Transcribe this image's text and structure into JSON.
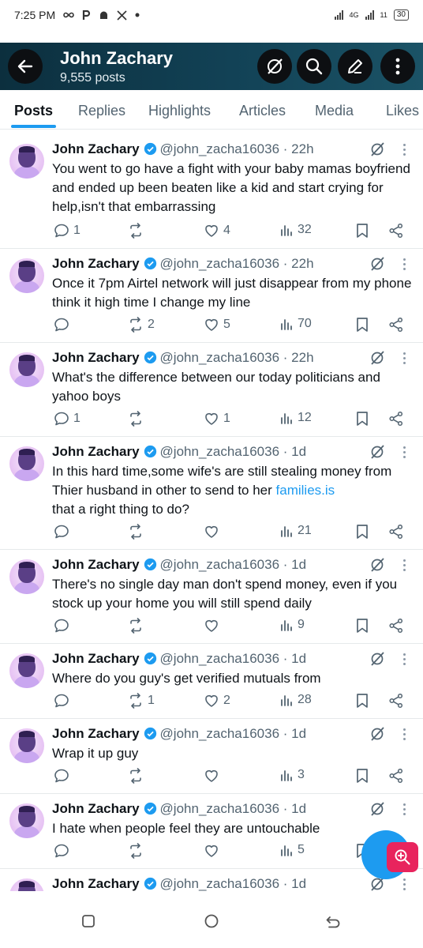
{
  "status_bar": {
    "time": "7:25 PM",
    "app_icons": [
      "infinity-icon",
      "p-icon",
      "android-icon",
      "x-icon",
      "dot-icon"
    ],
    "network": "4G",
    "signal2": "11",
    "battery": "30"
  },
  "header": {
    "name": "John Zachary",
    "post_count": "9,555 posts"
  },
  "tabs": [
    {
      "label": "Posts",
      "active": true
    },
    {
      "label": "Replies"
    },
    {
      "label": "Highlights"
    },
    {
      "label": "Articles"
    },
    {
      "label": "Media"
    },
    {
      "label": "Likes"
    }
  ],
  "tweets": [
    {
      "name": "John Zachary",
      "handle": "@john_zacha16036",
      "time": "· 22h",
      "text": "You went to go have a fight with your baby mamas boyfriend and ended up been beaten like a kid and start crying for help,isn't that embarrassing",
      "replies": "1",
      "reposts": "",
      "likes": "4",
      "views": "32"
    },
    {
      "name": "John Zachary",
      "handle": "@john_zacha16036",
      "time": "· 22h",
      "text": "Once it 7pm Airtel network will just disappear from my phone think it high time I change my line",
      "replies": "",
      "reposts": "2",
      "likes": "5",
      "views": "70"
    },
    {
      "name": "John Zachary",
      "handle": "@john_zacha16036",
      "time": "· 22h",
      "text": "What's the difference between our today politicians and yahoo boys",
      "replies": "1",
      "reposts": "",
      "likes": "1",
      "views": "12"
    },
    {
      "name": "John Zachary",
      "handle": "@john_zacha16036",
      "time": "· 1d",
      "text": "In this hard time,some wife's are still stealing money from Thier husband in other to send to her",
      "link": "families.is",
      "text_after": "that a right thing to do?",
      "replies": "",
      "reposts": "",
      "likes": "",
      "views": "21"
    },
    {
      "name": "John Zachary",
      "handle": "@john_zacha16036",
      "time": "· 1d",
      "text": "There's no single day man don't spend money, even if you stock up your home you will still spend daily",
      "replies": "",
      "reposts": "",
      "likes": "",
      "views": "9"
    },
    {
      "name": "John Zachary",
      "handle": "@john_zacha16036",
      "time": "· 1d",
      "text": "Where do you guy's get verified mutuals from",
      "replies": "",
      "reposts": "1",
      "likes": "2",
      "views": "28"
    },
    {
      "name": "John Zachary",
      "handle": "@john_zacha16036",
      "time": "· 1d",
      "text": "Wrap it up guy",
      "replies": "",
      "reposts": "",
      "likes": "",
      "views": "3"
    },
    {
      "name": "John Zachary",
      "handle": "@john_zacha16036",
      "time": "· 1d",
      "text": "I hate when people feel they are untouchable",
      "replies": "",
      "reposts": "",
      "likes": "",
      "views": "5"
    },
    {
      "name": "John Zachary",
      "handle": "@john_zacha16036",
      "time": "· 1d",
      "text": "",
      "replies": "",
      "reposts": "",
      "likes": "",
      "views": ""
    }
  ],
  "colors": {
    "accent": "#1d9bf0",
    "header_bg": "#124256",
    "fab_zoom": "#e8245d",
    "secondary_text": "#536471"
  }
}
